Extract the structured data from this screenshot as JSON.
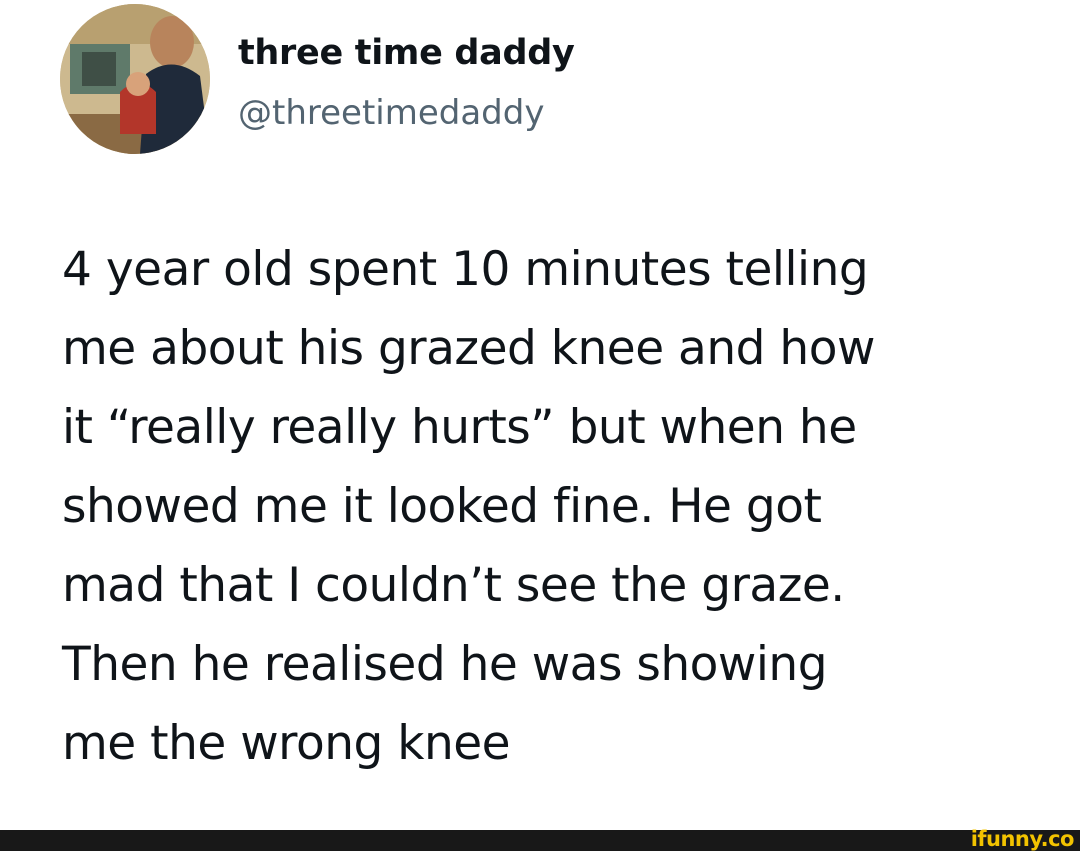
{
  "author": {
    "display_name": "three time daddy",
    "handle": "@threetimedaddy"
  },
  "tweet": {
    "lines": [
      "4 year old spent 10 minutes telling",
      "me about his grazed knee and how",
      "it “really really hurts” but when he",
      "showed me it looked fine. He got",
      "mad that I couldn’t see the graze.",
      "Then he realised he was showing",
      "me the wrong knee"
    ]
  },
  "watermark": {
    "text": "ifunny.co"
  },
  "colors": {
    "name": "#0f1419",
    "handle": "#536471",
    "watermark": "#f2c300",
    "footer": "#181818"
  }
}
